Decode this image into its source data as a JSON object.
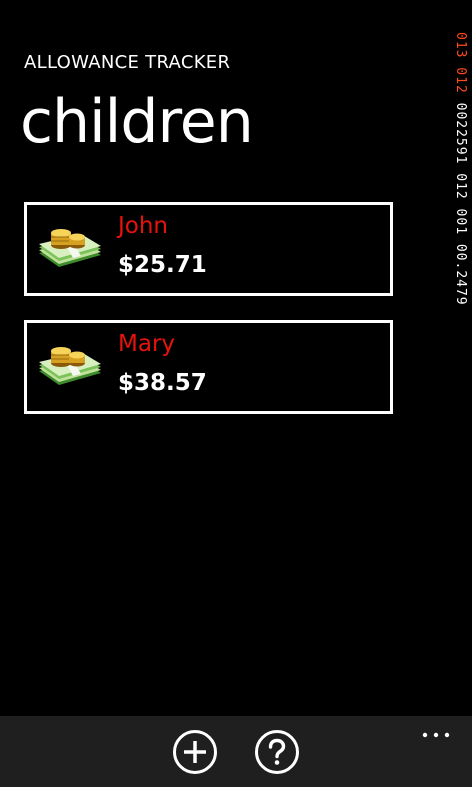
{
  "header": {
    "app_title": "ALLOWANCE TRACKER",
    "page_title": "children"
  },
  "debug_counter": {
    "part1": "013 012",
    "part2": "0022591 012 001 00.2479"
  },
  "children": [
    {
      "name": "John",
      "balance": "$25.71",
      "icon": "money-stack-icon"
    },
    {
      "name": "Mary",
      "balance": "$38.57",
      "icon": "money-stack-icon"
    }
  ],
  "app_bar": {
    "buttons": [
      {
        "icon": "add-icon"
      },
      {
        "icon": "help-icon"
      }
    ],
    "more_icon": "more-dots-icon"
  },
  "colors": {
    "background": "#000000",
    "name_accent": "#e8120c",
    "app_bar": "#1f1f1f"
  }
}
